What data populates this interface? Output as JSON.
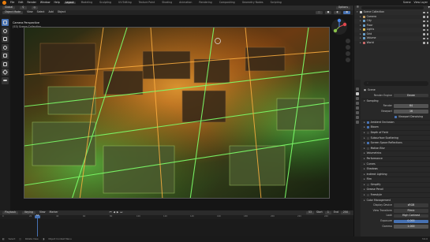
{
  "topbar": {
    "menus": [
      "File",
      "Edit",
      "Render",
      "Window",
      "Help"
    ],
    "tabs": [
      "Layout",
      "Modeling",
      "Sculpting",
      "UV Editing",
      "Texture Paint",
      "Shading",
      "Animation",
      "Rendering",
      "Compositing",
      "Geometry Nodes",
      "Scripting"
    ],
    "active_tab": "Layout",
    "scene": "Scene",
    "view_layer": "View Layer"
  },
  "tool_header": {
    "mode": "Object Mode",
    "view": "View",
    "select": "Select",
    "add": "Add",
    "object": "Object",
    "orientation": "Global",
    "options": "Options"
  },
  "viewport": {
    "label1": "Camera Perspective",
    "label2": "(53) Scene Collection"
  },
  "outliner": {
    "search": "Scene Collection",
    "rows": [
      {
        "name": "Scene Collection",
        "color": "#cccccc",
        "indent": 0
      },
      {
        "name": "Camera",
        "color": "#c9a46a",
        "indent": 1
      },
      {
        "name": "City",
        "color": "#6aa0c9",
        "indent": 1
      },
      {
        "name": "Floor",
        "color": "#6aa0c9",
        "indent": 1
      },
      {
        "name": "Lights",
        "color": "#e0c35a",
        "indent": 1
      },
      {
        "name": "Grid",
        "color": "#6aa0c9",
        "indent": 1
      },
      {
        "name": "Volume",
        "color": "#6aa0c9",
        "indent": 1
      },
      {
        "name": "World",
        "color": "#c96a6a",
        "indent": 1
      }
    ]
  },
  "properties": {
    "search_placeholder": "",
    "scene_name": "Scene",
    "render_engine_label": "Render Engine",
    "render_engine": "Eevee",
    "sampling": "Sampling",
    "render_label": "Render",
    "render_samples": "64",
    "viewport_label": "Viewport",
    "viewport_samples": "16",
    "viewport_denoising": "Viewport Denoising",
    "sections": [
      {
        "name": "Ambient Occlusion",
        "check": true
      },
      {
        "name": "Bloom",
        "check": true
      },
      {
        "name": "Depth of Field",
        "check": false
      },
      {
        "name": "Subsurface Scattering",
        "check": false
      },
      {
        "name": "Screen Space Reflections",
        "check": true
      },
      {
        "name": "Motion Blur",
        "check": false
      },
      {
        "name": "Volumetrics",
        "check": null
      },
      {
        "name": "Performance",
        "check": null
      },
      {
        "name": "Curves",
        "check": null
      },
      {
        "name": "Shadows",
        "check": null
      },
      {
        "name": "Indirect Lighting",
        "check": null
      },
      {
        "name": "Film",
        "check": null
      },
      {
        "name": "Simplify",
        "check": false
      },
      {
        "name": "Grease Pencil",
        "check": null
      },
      {
        "name": "Freestyle",
        "check": false
      },
      {
        "name": "Color Management",
        "check": null
      }
    ],
    "display_device_label": "Display Device",
    "display_device": "sRGB",
    "view_transform_label": "View Transform",
    "view_transform": "Filmic",
    "look_label": "Look",
    "look": "High Contrast",
    "exposure_label": "Exposure",
    "exposure": "0.000",
    "gamma_label": "Gamma",
    "gamma": "1.000"
  },
  "timeline": {
    "playback": "Playback",
    "keying": "Keying",
    "view": "View",
    "marker": "Marker",
    "current_frame": "53",
    "start_label": "Start",
    "start": "1",
    "end_label": "End",
    "end": "250",
    "ticks": [
      "0",
      "20",
      "40",
      "60",
      "80",
      "100",
      "120",
      "140",
      "160",
      "180",
      "200",
      "220",
      "240"
    ]
  },
  "statusbar": {
    "select": "Select",
    "rotate": "Rotate View",
    "context": "Object Context Menu",
    "version": "3.0.0"
  }
}
